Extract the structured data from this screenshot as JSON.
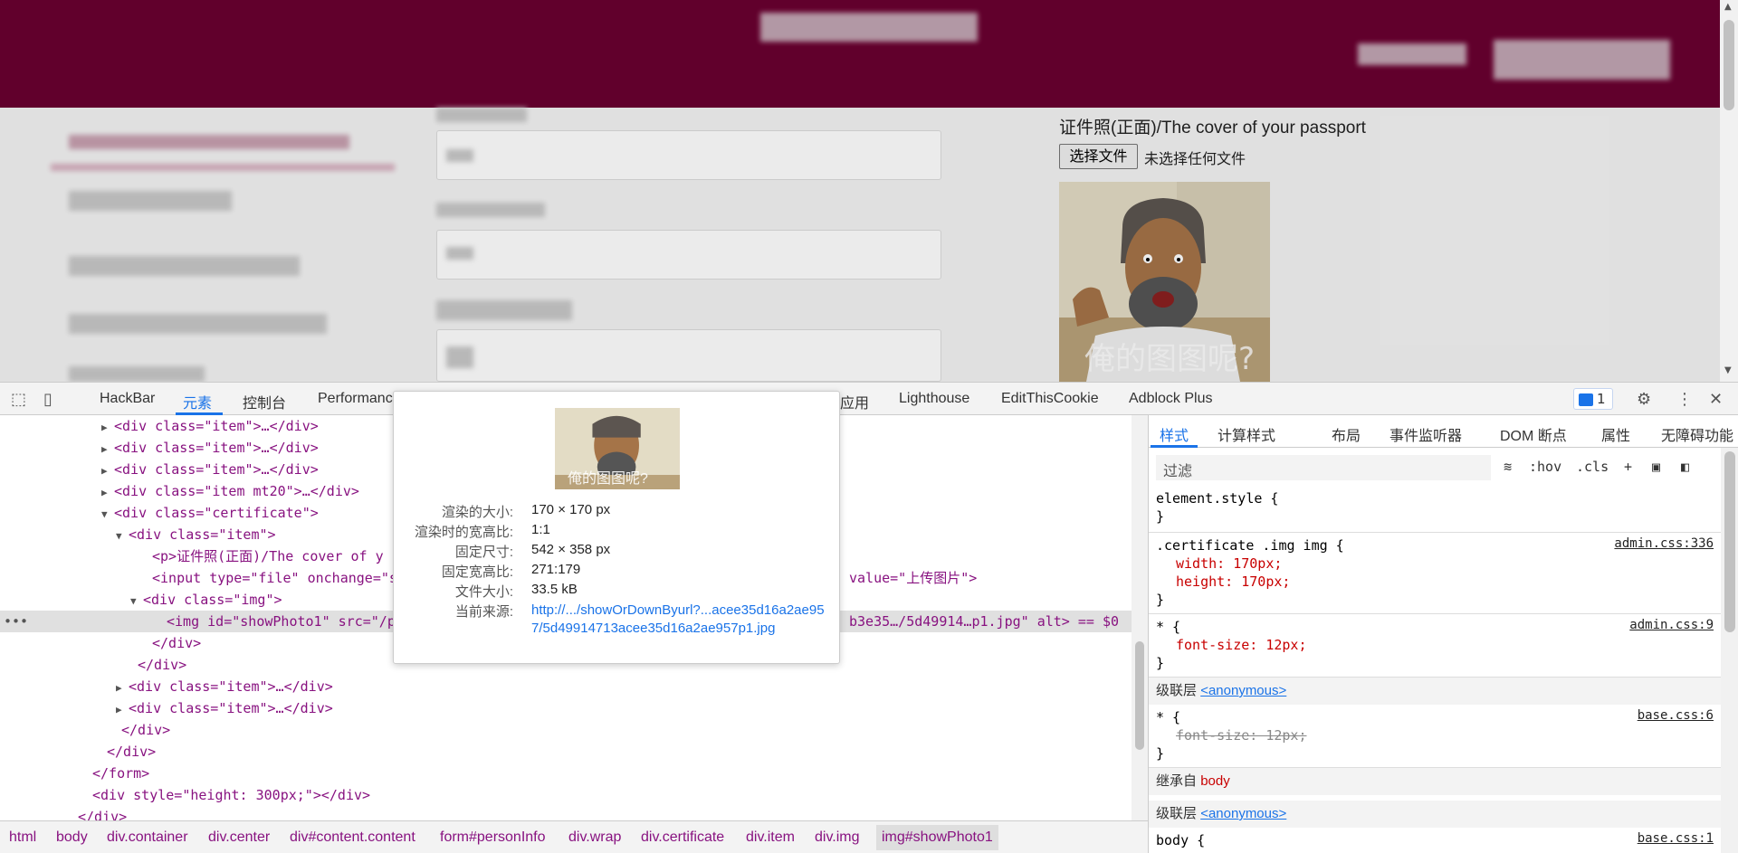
{
  "page": {
    "cert_label": "证件照(正面)/The cover of your passport",
    "file_button": "选择文件",
    "file_status": "未选择任何文件",
    "photo_caption": "俺的图图呢?"
  },
  "devtools": {
    "tabs": [
      "HackBar",
      "元素",
      "控制台",
      "Performanc",
      "应用",
      "Lighthouse",
      "EditThisCookie",
      "Adblock Plus"
    ],
    "active_tab": "元素",
    "issues_count": "1",
    "elements_lines": [
      {
        "indent": 126,
        "tri": "▶",
        "html": "<div class=\"item\">…</div>"
      },
      {
        "indent": 126,
        "tri": "▶",
        "html": "<div class=\"item\">…</div>"
      },
      {
        "indent": 126,
        "tri": "▶",
        "html": "<div class=\"item\">…</div>"
      },
      {
        "indent": 126,
        "tri": "▶",
        "html": "<div class=\"item mt20\">…</div>"
      },
      {
        "indent": 126,
        "tri": "▼",
        "html": "<div class=\"certificate\">"
      },
      {
        "indent": 142,
        "tri": "▼",
        "html": "<div class=\"item\">"
      },
      {
        "indent": 168,
        "tri": "",
        "html": "<p>证件照(正面)/The cover of y"
      },
      {
        "indent": 168,
        "tri": "",
        "html": "<input type=\"file\" onchange=\"s"
      },
      {
        "indent": 158,
        "tri": "▼",
        "html": "<div class=\"img\">"
      },
      {
        "indent": 184,
        "tri": "",
        "html": "<img id=\"showPhoto1\" src=\"/p"
      },
      {
        "indent": 168,
        "tri": "",
        "html": "</div>"
      },
      {
        "indent": 152,
        "tri": "",
        "html": "</div>"
      },
      {
        "indent": 142,
        "tri": "▶",
        "html": "<div class=\"item\">…</div>"
      },
      {
        "indent": 142,
        "tri": "▶",
        "html": "<div class=\"item\">…</div>"
      },
      {
        "indent": 134,
        "tri": "",
        "html": "</div>"
      },
      {
        "indent": 118,
        "tri": "",
        "html": "</div>"
      },
      {
        "indent": 102,
        "tri": "",
        "html": "</form>"
      },
      {
        "indent": 102,
        "tri": "",
        "html": "<div style=\"height: 300px;\"></div>"
      },
      {
        "indent": 86,
        "tri": "",
        "html": "</div>"
      }
    ],
    "input_tail": "value=\"上传图片\">",
    "img_tail": "b3e35…/5d49914…p1.jpg\" alt> == $0",
    "breadcrumb": [
      "html",
      "body",
      "div.container",
      "div.center",
      "div#content.content",
      "form#personInfo",
      "div.wrap",
      "div.certificate",
      "div.item",
      "div.img",
      "img#showPhoto1"
    ],
    "side_tabs": [
      "样式",
      "计算样式",
      "布局",
      "事件监听器",
      "DOM 断点",
      "属性",
      "无障碍功能"
    ],
    "filter_placeholder": "过滤",
    "filter_tools": [
      ":hov",
      ".cls",
      "+"
    ],
    "styles": {
      "element_style": "element.style {",
      "rule1_selector": ".certificate .img img {",
      "rule1_src": "admin.css:336",
      "rule1_width": "width: 170px;",
      "rule1_height": "height: 170px;",
      "rule2_selector": "* {",
      "rule2_src": "admin.css:9",
      "rule2_prop": "font-size: 12px;",
      "layer_label": "级联层",
      "layer_link": "<anonymous>",
      "rule3_selector": "* {",
      "rule3_src": "base.css:6",
      "rule3_prop": "font-size: 12px;",
      "inherit_label": "继承自",
      "inherit_tag": "body",
      "layer2_link": "<anonymous>",
      "rule4_selector": "body {",
      "rule4_src": "base.css:1",
      "close_brace": "}"
    },
    "tooltip": {
      "rendered_size_k": "渲染的大小:",
      "rendered_size_v": "170 × 170 px",
      "rendered_ratio_k": "渲染时的宽高比:",
      "rendered_ratio_v": "1:1",
      "intrinsic_size_k": "固定尺寸:",
      "intrinsic_size_v": "542 × 358 px",
      "intrinsic_ratio_k": "固定宽高比:",
      "intrinsic_ratio_v": "271:179",
      "file_size_k": "文件大小:",
      "file_size_v": "33.5 kB",
      "source_k": "当前来源:",
      "source_v": "http://.../showOrDownByurl?...acee35d16a2ae957/5d49914713acee35d16a2ae957p1.jpg",
      "img_caption": "俺的图图呢?"
    }
  }
}
